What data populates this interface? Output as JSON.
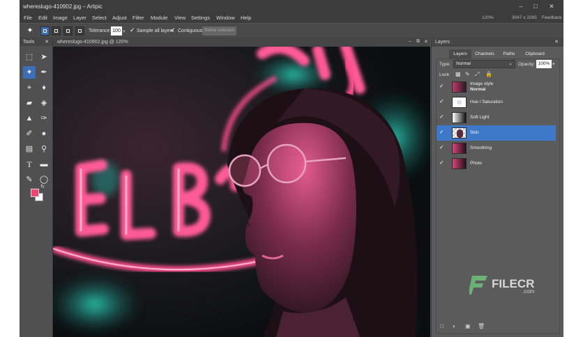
{
  "window": {
    "title": "whereslugo-410902.jpg – Artipic",
    "minimize_icon": "minimize-icon",
    "maximize_icon": "maximize-icon",
    "close_icon": "close-icon"
  },
  "menu": {
    "items": [
      "File",
      "Edit",
      "Image",
      "Layer",
      "Select",
      "Adjust",
      "Filter",
      "Module",
      "View",
      "Settings",
      "Window",
      "Help"
    ],
    "zoom": "120%",
    "dimensions": "3047 x 2265",
    "feedback": "Feedback"
  },
  "options": {
    "tolerance_label": "Tolerance:",
    "tolerance_value": "100",
    "sample_all_layers": "Sample all layers",
    "contiguous": "Contiguous",
    "refine_selection": "Refine selection"
  },
  "tools": {
    "title": "Tools",
    "foreground_color": "#f2466f",
    "background_color": "#ffffff"
  },
  "document": {
    "tab_title": "whereslugo-410902.jpg @ 120%"
  },
  "layers_panel": {
    "title": "Layers",
    "tabs": [
      "Layers",
      "Channels",
      "Paths",
      "Clipboard"
    ],
    "active_tab": "Layers",
    "type_label": "Type:",
    "type_value": "Normal",
    "opacity_label": "Opacity:",
    "opacity_value": "100%",
    "lock_label": "Lock:",
    "image_style_title": "Image style",
    "image_style_mode": "Normal",
    "layers": [
      {
        "name": "Hue / Saturation",
        "visible": true,
        "selected": false
      },
      {
        "name": "Soft Light",
        "visible": true,
        "selected": false
      },
      {
        "name": "Skin",
        "visible": true,
        "selected": true
      },
      {
        "name": "Smoothing",
        "visible": true,
        "selected": false
      },
      {
        "name": "Photo",
        "visible": true,
        "selected": false
      }
    ]
  },
  "watermark": {
    "brand": "FILECR",
    "domain": ".com"
  },
  "colors": {
    "accent": "#3e79c9",
    "neon_pink": "#ff3d8a",
    "neon_teal": "#1fd8c2"
  }
}
